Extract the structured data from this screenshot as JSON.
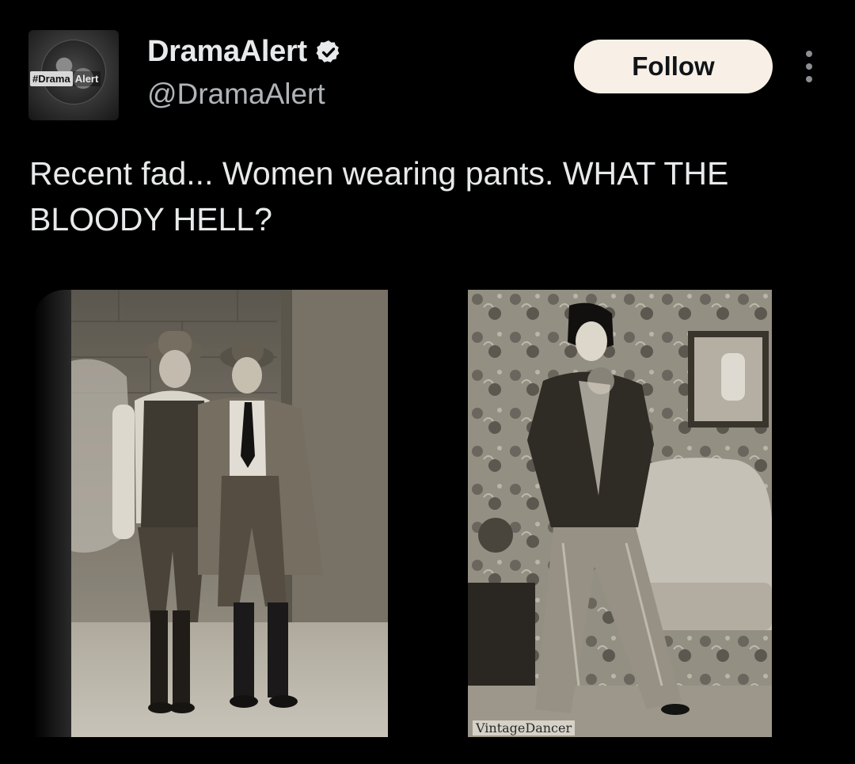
{
  "author": {
    "display_name": "DramaAlert",
    "handle": "@DramaAlert",
    "verified": true,
    "avatar_tag_left": "#Drama",
    "avatar_tag_right": "Alert"
  },
  "actions": {
    "follow_label": "Follow",
    "more_icon": "more-vertical-icon"
  },
  "tweet": {
    "text": "Recent fad... Women wearing pants. WHAT THE BLOODY HELL?"
  },
  "media": {
    "right_watermark": "VintageDancer"
  },
  "colors": {
    "background": "#000000",
    "text_primary": "#e7e9ea",
    "text_secondary": "#b0b4b8",
    "follow_bg": "#f8f0e6"
  }
}
